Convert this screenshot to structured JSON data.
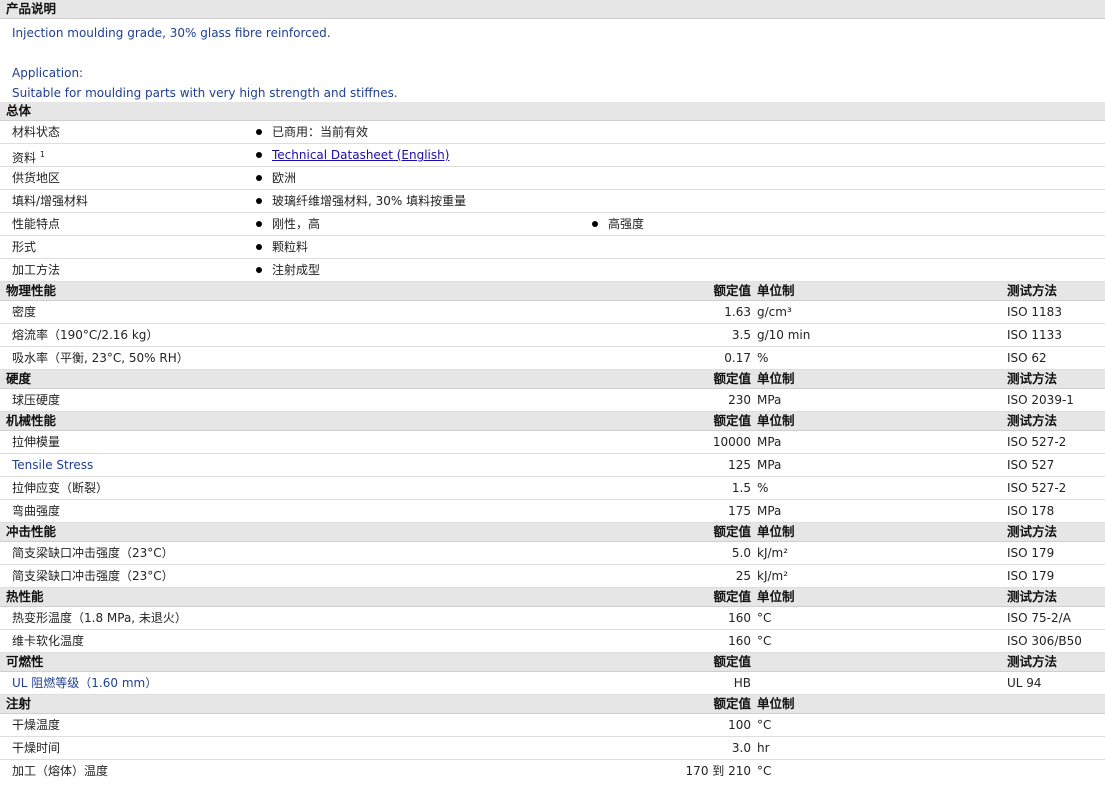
{
  "description": {
    "header": "产品说明",
    "line1": "Injection moulding grade, 30% glass fibre reinforced.",
    "line2": "Application:",
    "line3": "Suitable for moulding parts with very high strength and stiffnes."
  },
  "general": {
    "header": "总体",
    "rows": [
      {
        "label": "材料状态",
        "value": "已商用：当前有效"
      },
      {
        "label": "资料",
        "sup": "1",
        "value": "Technical Datasheet (English)"
      },
      {
        "label": "供货地区",
        "value": "欧洲"
      },
      {
        "label": "填料/增强材料",
        "value": "玻璃纤维增强材料, 30% 填料按重量"
      },
      {
        "label": "性能特点",
        "value": "刚性，高",
        "value2": "高强度"
      },
      {
        "label": "形式",
        "value": "颗粒料"
      },
      {
        "label": "加工方法",
        "value": "注射成型"
      }
    ]
  },
  "columns": {
    "value": "额定值",
    "unit": "单位制",
    "test": "测试方法"
  },
  "physical": {
    "header": "物理性能",
    "rows": [
      {
        "label": "密度",
        "value": "1.63",
        "unit": "g/cm³",
        "test": "ISO 1183"
      },
      {
        "label": "熔流率（190°C/2.16 kg）",
        "value": "3.5",
        "unit": "g/10 min",
        "test": "ISO 1133"
      },
      {
        "label": "吸水率（平衡, 23°C, 50% RH）",
        "value": "0.17",
        "unit": "%",
        "test": "ISO 62"
      }
    ]
  },
  "hardness": {
    "header": "硬度",
    "rows": [
      {
        "label": "球压硬度",
        "value": "230",
        "unit": "MPa",
        "test": "ISO 2039-1"
      }
    ]
  },
  "mechanical": {
    "header": "机械性能",
    "rows": [
      {
        "label": "拉伸模量",
        "value": "10000",
        "unit": "MPa",
        "test": "ISO 527-2"
      },
      {
        "label": "Tensile Stress",
        "value": "125",
        "unit": "MPa",
        "test": "ISO 527"
      },
      {
        "label": "拉伸应变（断裂）",
        "value": "1.5",
        "unit": "%",
        "test": "ISO 527-2"
      },
      {
        "label": "弯曲强度",
        "value": "175",
        "unit": "MPa",
        "test": "ISO 178"
      }
    ]
  },
  "impact": {
    "header": "冲击性能",
    "rows": [
      {
        "label": "简支梁缺口冲击强度（23°C）",
        "value": "5.0",
        "unit": "kJ/m²",
        "test": "ISO 179"
      },
      {
        "label": "简支梁缺口冲击强度（23°C）",
        "value": "25",
        "unit": "kJ/m²",
        "test": "ISO 179"
      }
    ]
  },
  "thermal": {
    "header": "热性能",
    "rows": [
      {
        "label": "热变形温度（1.8 MPa, 未退火）",
        "value": "160",
        "unit": "°C",
        "test": "ISO 75-2/A"
      },
      {
        "label": "维卡软化温度",
        "value": "160",
        "unit": "°C",
        "test": "ISO 306/B50"
      }
    ]
  },
  "flammability": {
    "header": "可燃性",
    "rows": [
      {
        "label": "UL 阻燃等级（1.60 mm）",
        "value": "HB",
        "unit": "",
        "test": "UL 94"
      }
    ]
  },
  "injection": {
    "header": "注射",
    "rows": [
      {
        "label": "干燥温度",
        "value": "100",
        "unit": "°C",
        "test": ""
      },
      {
        "label": "干燥时间",
        "value": "3.0",
        "unit": "hr",
        "test": ""
      },
      {
        "label": "加工（熔体）温度",
        "value": "170 到  210",
        "unit": "°C",
        "test": ""
      }
    ]
  }
}
